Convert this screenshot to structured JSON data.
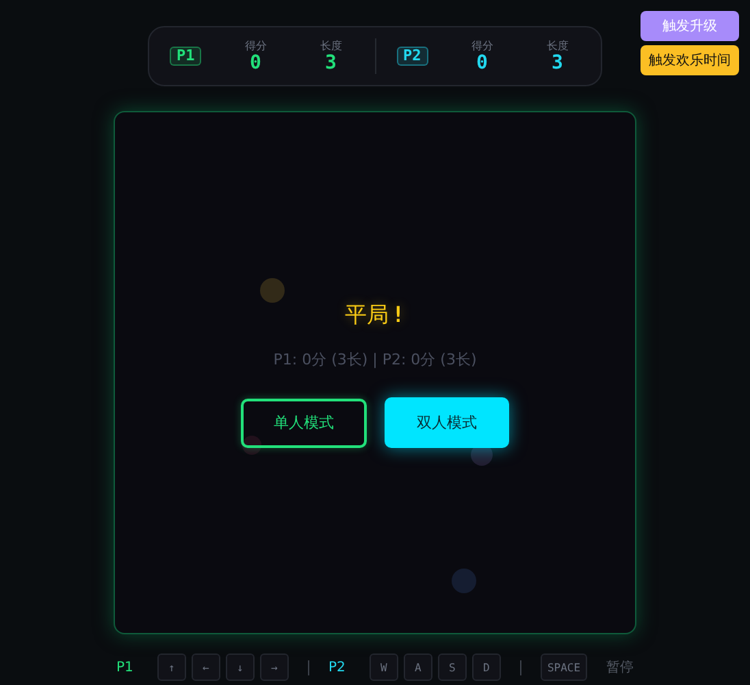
{
  "scoreboard": {
    "players": [
      {
        "tag": "P1",
        "color": "#22e07a",
        "stats": [
          {
            "label": "得分",
            "value": "0"
          },
          {
            "label": "长度",
            "value": "3"
          }
        ]
      },
      {
        "tag": "P2",
        "color": "#22d8ee",
        "stats": [
          {
            "label": "得分",
            "value": "0"
          },
          {
            "label": "长度",
            "value": "3"
          }
        ]
      }
    ]
  },
  "side_buttons": [
    {
      "label": "触发升级",
      "color": "#a78bfa"
    },
    {
      "label": "触发欢乐时间",
      "color": "#fbbf24"
    }
  ],
  "result": {
    "title": "平局",
    "mark": "!",
    "summary": "P1: 0分 (3长) | P2: 0分 (3长)"
  },
  "mode_buttons": [
    {
      "label": "单人模式",
      "selected": false
    },
    {
      "label": "双人模式",
      "selected": true
    }
  ],
  "controls": [
    {
      "player": "P1",
      "color": "#22e07a",
      "keys": [
        "↑",
        "←",
        "↓",
        "→"
      ]
    },
    {
      "player": "P2",
      "color": "#22d8ee",
      "keys": [
        "W",
        "A",
        "S",
        "D"
      ]
    }
  ],
  "pause": {
    "key": "SPACE",
    "label": "暂停"
  }
}
